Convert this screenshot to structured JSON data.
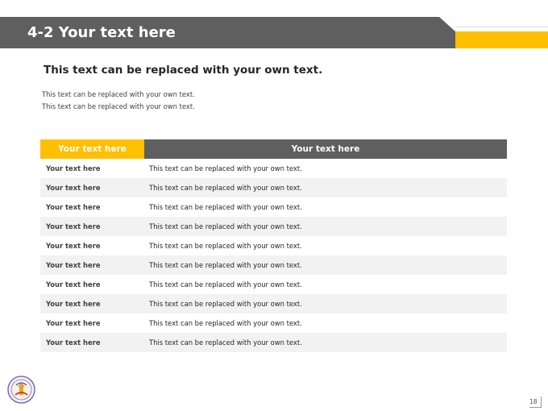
{
  "header": {
    "title": "4-2 Your text here"
  },
  "colors": {
    "accent": "#ffc000",
    "dark": "#5f5f5f"
  },
  "content": {
    "subtitle": "This text can be replaced with your own text.",
    "lines": [
      "This text can be replaced with your own text.",
      "This text can be replaced with your own text."
    ]
  },
  "table": {
    "headers": [
      "Your text here",
      "Your text here"
    ],
    "rows": [
      [
        "Your text here",
        "This text can be replaced with your own text."
      ],
      [
        "Your text here",
        "This text can be replaced with your own text."
      ],
      [
        "Your text here",
        "This text can be replaced with your own text."
      ],
      [
        "Your text here",
        "This text can be replaced with your own text."
      ],
      [
        "Your text here",
        "This text can be replaced with your own text."
      ],
      [
        "Your text here",
        "This text can be replaced with your own text."
      ],
      [
        "Your text here",
        "This text can be replaced with your own text."
      ],
      [
        "Your text here",
        "This text can be replaced with your own text."
      ],
      [
        "Your text here",
        "This text can be replaced with your own text."
      ],
      [
        "Your text here",
        "This text can be replaced with your own text."
      ]
    ]
  },
  "footer": {
    "logo_icon": "seal-logo-icon",
    "page_number": "18"
  }
}
